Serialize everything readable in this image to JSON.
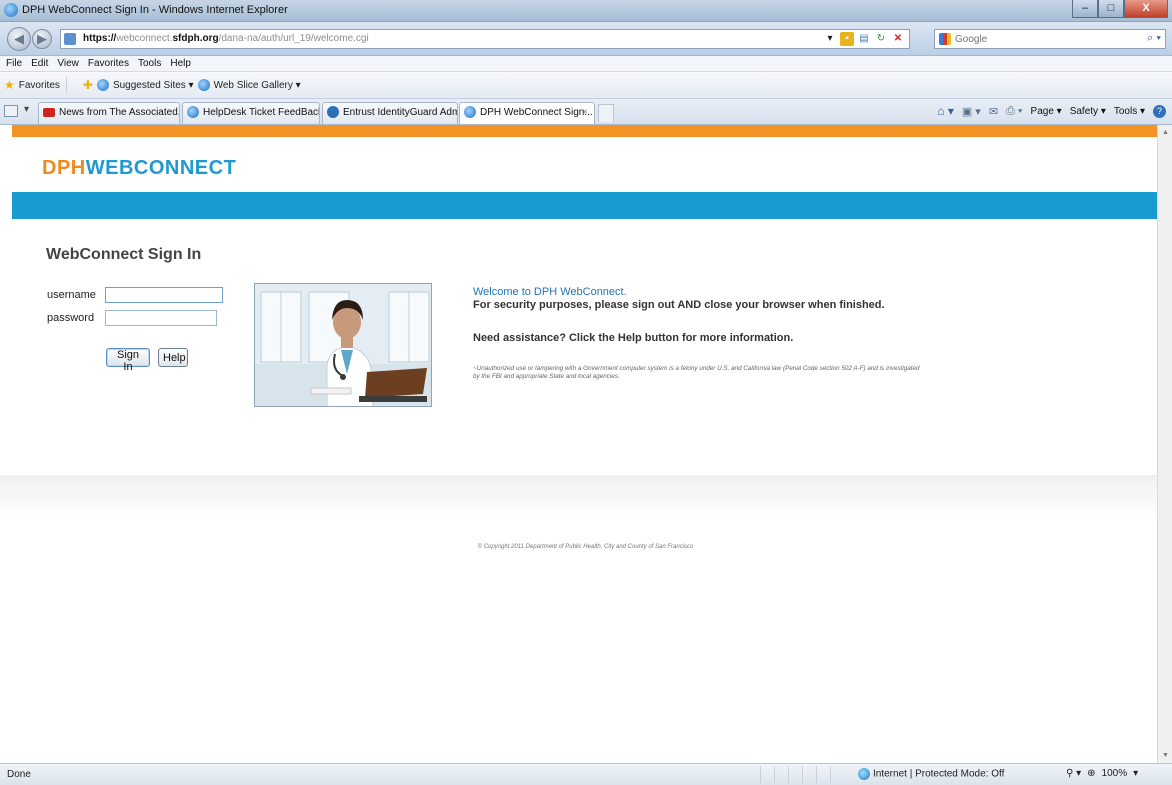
{
  "window": {
    "title": "DPH WebConnect Sign In - Windows Internet Explorer",
    "min_label": "–",
    "max_label": "□",
    "close_label": "X"
  },
  "address_bar": {
    "url_scheme": "https://",
    "url_host_sub": "webconnect.",
    "url_host_main": "sfdph.org",
    "url_path": "/dana-na/auth/url_19/welcome.cgi",
    "search_placeholder": "Google"
  },
  "menu": [
    "File",
    "Edit",
    "View",
    "Favorites",
    "Tools",
    "Help"
  ],
  "favorites_bar": {
    "favorites_label": "Favorites",
    "suggested_sites": "Suggested Sites ▾",
    "web_slice_gallery": "Web Slice Gallery ▾"
  },
  "tabs": [
    {
      "label": "News from The Associated..."
    },
    {
      "label": "HelpDesk Ticket FeedBack"
    },
    {
      "label": "Entrust IdentityGuard Adm..."
    },
    {
      "label": "DPH WebConnect Sign..."
    }
  ],
  "command_bar": {
    "page": "Page ▾",
    "safety": "Safety ▾",
    "tools": "Tools ▾",
    "help": "?"
  },
  "page": {
    "logo_dph": "DPH",
    "logo_webconnect": "WEBCONNECT",
    "signin_title": "WebConnect Sign In",
    "username_label": "username",
    "password_label": "password",
    "username_value": "",
    "password_value": "",
    "signin_button": "Sign In",
    "help_button": "Help",
    "welcome": "Welcome to DPH WebConnect.",
    "security_msg": "For security purposes, please sign out AND close your browser when finished.",
    "assist_msg": "Need assistance? Click the Help button for more information.",
    "legal_msg": "~Unauthorized use or tampering with a Government computer system is a felony under U.S. and California law (Penal Code section 502 A-F) and is investigated by the FBI and appropriate State and local agencies.",
    "copyright": "© Copyright 2011 Department of Public Health, City and County of San Francisco"
  },
  "status_bar": {
    "status": "Done",
    "zone": "Internet | Protected Mode: Off",
    "zoom": "100%"
  },
  "colors": {
    "orange": "#f39325",
    "blue": "#179bd0"
  }
}
